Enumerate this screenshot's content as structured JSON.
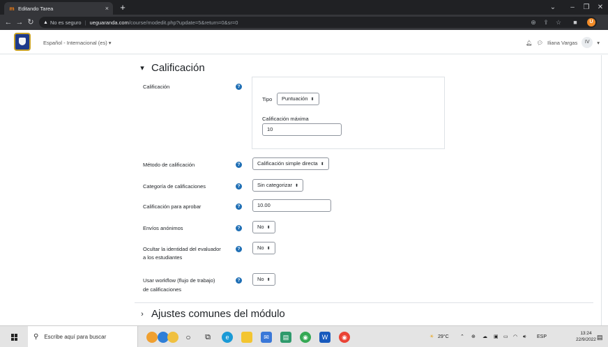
{
  "browser": {
    "tab_title": "Editando Tarea",
    "tab_icon": "m",
    "tab_close": "×",
    "new_tab": "+",
    "url_security": "No es seguro",
    "url_host": "ueguaranda.com",
    "url_path": "/course/modedit.php?update=5&return=0&sr=0",
    "profile_initial": "U"
  },
  "navbar": {
    "language": "Español - Internacional (es) ▾",
    "user_name": "Iliana Vargas",
    "user_initials": "IV",
    "user_caret": "▾"
  },
  "form": {
    "section_title": "Calificación",
    "grade_label": "Calificación",
    "type_label": "Tipo",
    "type_value": "Puntuación",
    "max_grade_label": "Calificación máxima",
    "max_grade_value": "10",
    "method_label": "Método de calificación",
    "method_value": "Calificación simple directa",
    "category_label": "Categoría de calificaciones",
    "category_value": "Sin categorizar",
    "pass_label": "Calificación para aprobar",
    "pass_value": "10.00",
    "anon_label": "Envíos anónimos",
    "anon_value": "No",
    "hide_label_1": "Ocultar la identidad del evaluador",
    "hide_label_2": "a los estudiantes",
    "hide_value": "No",
    "workflow_label_1": "Usar workflow (flujo de trabajo)",
    "workflow_label_2": "de calificaciones",
    "workflow_value": "No",
    "next_section_title": "Ajustes comunes del módulo"
  },
  "taskbar": {
    "search_placeholder": "Escribe aquí para buscar",
    "weather": "29°C",
    "lang": "ESP",
    "time": "13:24",
    "date": "22/9/2022"
  }
}
